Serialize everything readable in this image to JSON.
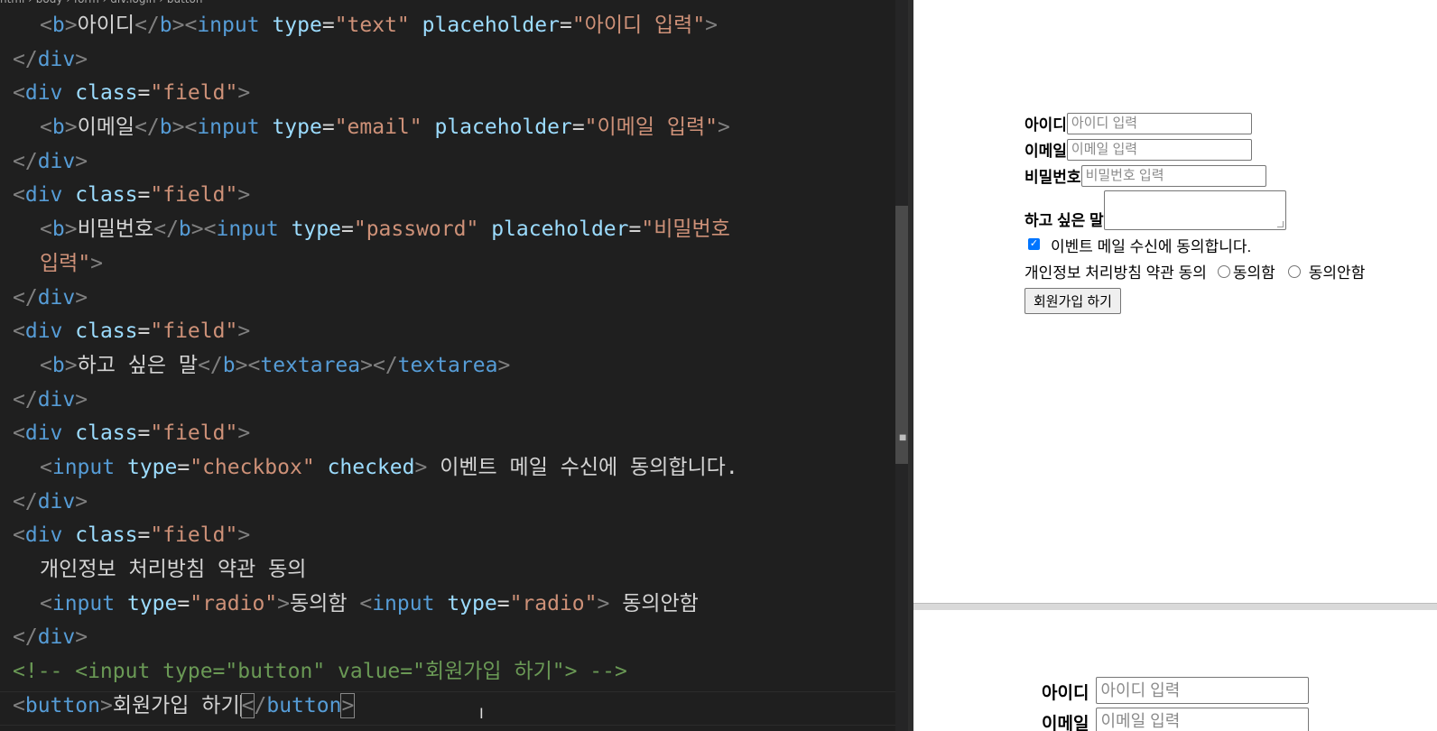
{
  "editor": {
    "breadcrumb": "html  ›  body  ›  form  ›  div.login  ›  button",
    "lines": {
      "l1_text": "아이디",
      "l1_type": "\"text\"",
      "l1_ph": "\"아이디 입력\"",
      "l3_text": "이메일",
      "l3_type": "\"email\"",
      "l3_ph": "\"이메일 입력\"",
      "l5_text": "비밀번호",
      "l5_type": "\"password\"",
      "l5_ph1": "\"비밀번호",
      "l5_ph2": "입력\"",
      "l8_text": "하고 싶은 말",
      "l10_text": " 이벤트 메일 수신에 동의합니다.",
      "l12_text": "개인정보 처리방침 약관 동의",
      "l13_a": "동의함 ",
      "l13_b": " 동의안함",
      "comment": "<!-- <input type=\"button\" value=\"회원가입 하기\"> -->",
      "button_text": "회원가입 하기",
      "field_class": "\"field\""
    }
  },
  "preview": {
    "labels": {
      "id": "아이디",
      "email": "이메일",
      "password": "비밀번호",
      "message": "하고 싶은 말"
    },
    "placeholders": {
      "id": "아이디 입력",
      "email": "이메일 입력",
      "password": "비밀번호 입력"
    },
    "checkbox_label": "이벤트 메일 수신에 동의합니다.",
    "privacy_label": "개인정보 처리방침 약관 동의",
    "radio_agree": "동의함",
    "radio_disagree": "동의안함",
    "submit": "회원가입 하기",
    "second": {
      "id_label": "아이디",
      "id_placeholder": "아이디 입력",
      "email_label": "이메일",
      "email_placeholder": "이메일 입력"
    }
  }
}
